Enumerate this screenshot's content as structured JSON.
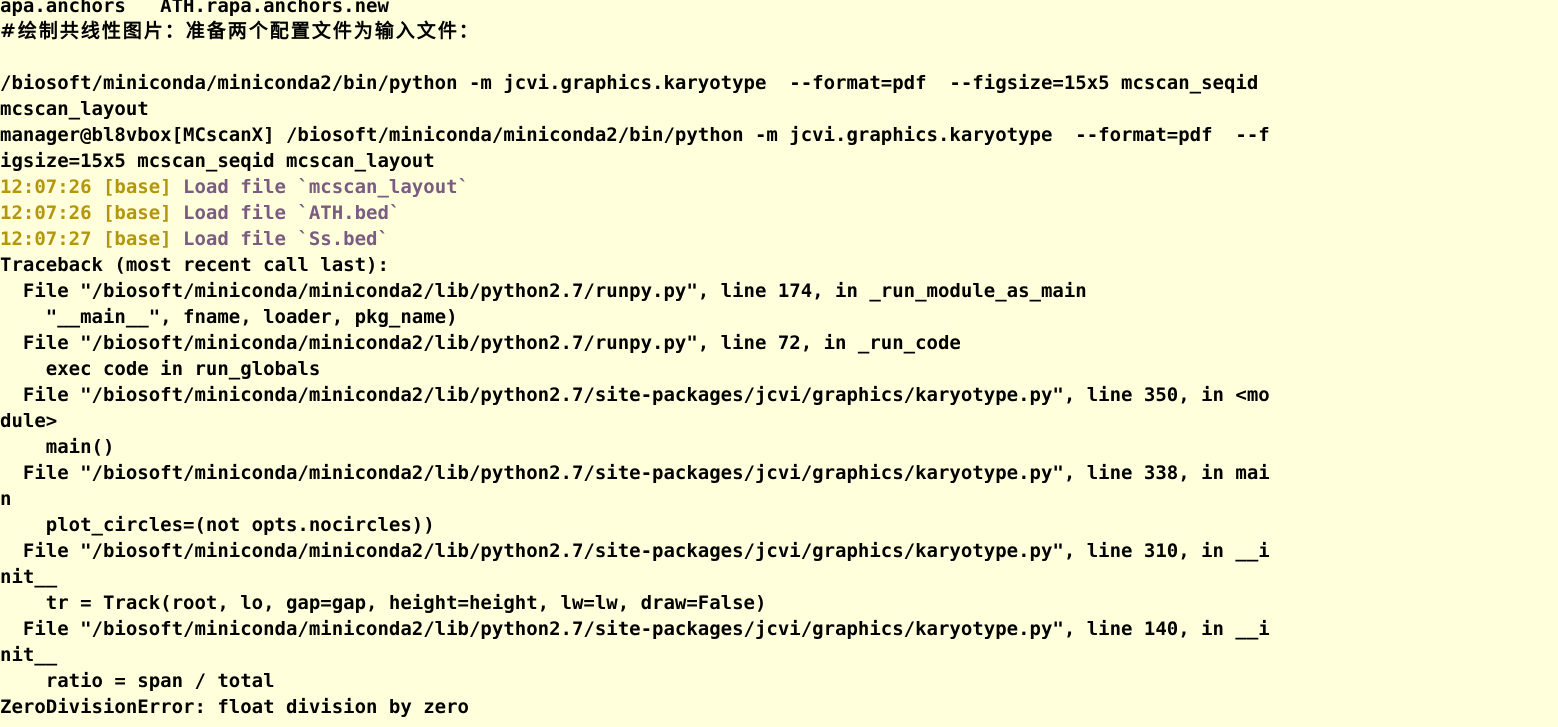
{
  "terminal": {
    "background_color": "#ffffdc",
    "foreground_color": "#000000",
    "timestamp_color": "#b3960c",
    "message_color": "#7a5b82",
    "font_size_px": 19,
    "line_height_px": 26,
    "columns": 80,
    "title": "manager@bl8vbox [MCscanX]"
  },
  "lines": [
    {
      "id": "line-anchors-files",
      "kind": "output",
      "segments": [
        {
          "text": "apa.anchors   ATH.rapa.anchors.new",
          "color": "default"
        }
      ]
    },
    {
      "id": "line-comment-cjk",
      "kind": "comment",
      "cjk": true,
      "segments": [
        {
          "text": "#绘制共线性图片：准备两个配置文件为输入文件：",
          "color": "default"
        }
      ]
    },
    {
      "id": "line-blank-1",
      "kind": "blank",
      "segments": [
        {
          "text": " ",
          "color": "blank"
        }
      ]
    },
    {
      "id": "line-command-wrapped-1",
      "kind": "command",
      "segments": [
        {
          "text": "/biosoft/miniconda/miniconda2/bin/python -m jcvi.graphics.karyotype  --format=pdf  --figsize=15x5 mcscan_seqid",
          "color": "default"
        }
      ]
    },
    {
      "id": "line-command-wrapped-2",
      "kind": "command",
      "segments": [
        {
          "text": "mcscan_layout",
          "color": "default"
        }
      ]
    },
    {
      "id": "line-prompt-command-1",
      "kind": "prompt",
      "segments": [
        {
          "text": "manager@bl8vbox[MCscanX] /biosoft/miniconda/miniconda2/bin/python -m jcvi.graphics.karyotype  --format=pdf  --f",
          "color": "default"
        }
      ]
    },
    {
      "id": "line-prompt-command-2",
      "kind": "prompt",
      "segments": [
        {
          "text": "igsize=15x5 mcscan_seqid mcscan_layout",
          "color": "default"
        }
      ]
    },
    {
      "id": "line-log-1",
      "kind": "log",
      "segments": [
        {
          "text": "12:07:26 [base] ",
          "color": "time"
        },
        {
          "text": "Load file `mcscan_layout`",
          "color": "msg"
        }
      ]
    },
    {
      "id": "line-log-2",
      "kind": "log",
      "segments": [
        {
          "text": "12:07:26 [base] ",
          "color": "time"
        },
        {
          "text": "Load file `ATH.bed`",
          "color": "msg"
        }
      ]
    },
    {
      "id": "line-log-3",
      "kind": "log",
      "segments": [
        {
          "text": "12:07:27 [base] ",
          "color": "time"
        },
        {
          "text": "Load file `Ss.bed`",
          "color": "msg"
        }
      ]
    },
    {
      "id": "line-traceback-header",
      "kind": "error",
      "segments": [
        {
          "text": "Traceback (most recent call last):",
          "color": "default"
        }
      ]
    },
    {
      "id": "line-tb-file-1",
      "kind": "error",
      "segments": [
        {
          "text": "  File \"/biosoft/miniconda/miniconda2/lib/python2.7/runpy.py\", line 174, in _run_module_as_main",
          "color": "default"
        }
      ]
    },
    {
      "id": "line-tb-code-1",
      "kind": "error",
      "segments": [
        {
          "text": "    \"__main__\", fname, loader, pkg_name)",
          "color": "default"
        }
      ]
    },
    {
      "id": "line-tb-file-2",
      "kind": "error",
      "segments": [
        {
          "text": "  File \"/biosoft/miniconda/miniconda2/lib/python2.7/runpy.py\", line 72, in _run_code",
          "color": "default"
        }
      ]
    },
    {
      "id": "line-tb-code-2",
      "kind": "error",
      "segments": [
        {
          "text": "    exec code in run_globals",
          "color": "default"
        }
      ]
    },
    {
      "id": "line-tb-file-3a",
      "kind": "error",
      "segments": [
        {
          "text": "  File \"/biosoft/miniconda/miniconda2/lib/python2.7/site-packages/jcvi/graphics/karyotype.py\", line 350, in <mo",
          "color": "default"
        }
      ]
    },
    {
      "id": "line-tb-file-3b",
      "kind": "error",
      "segments": [
        {
          "text": "dule>",
          "color": "default"
        }
      ]
    },
    {
      "id": "line-tb-code-3",
      "kind": "error",
      "segments": [
        {
          "text": "    main()",
          "color": "default"
        }
      ]
    },
    {
      "id": "line-tb-file-4a",
      "kind": "error",
      "segments": [
        {
          "text": "  File \"/biosoft/miniconda/miniconda2/lib/python2.7/site-packages/jcvi/graphics/karyotype.py\", line 338, in mai",
          "color": "default"
        }
      ]
    },
    {
      "id": "line-tb-file-4b",
      "kind": "error",
      "segments": [
        {
          "text": "n",
          "color": "default"
        }
      ]
    },
    {
      "id": "line-tb-code-4",
      "kind": "error",
      "segments": [
        {
          "text": "    plot_circles=(not opts.nocircles))",
          "color": "default"
        }
      ]
    },
    {
      "id": "line-tb-file-5a",
      "kind": "error",
      "segments": [
        {
          "text": "  File \"/biosoft/miniconda/miniconda2/lib/python2.7/site-packages/jcvi/graphics/karyotype.py\", line 310, in __i",
          "color": "default"
        }
      ]
    },
    {
      "id": "line-tb-file-5b",
      "kind": "error",
      "segments": [
        {
          "text": "nit__",
          "color": "default"
        }
      ]
    },
    {
      "id": "line-tb-code-5",
      "kind": "error",
      "segments": [
        {
          "text": "    tr = Track(root, lo, gap=gap, height=height, lw=lw, draw=False)",
          "color": "default"
        }
      ]
    },
    {
      "id": "line-tb-file-6a",
      "kind": "error",
      "segments": [
        {
          "text": "  File \"/biosoft/miniconda/miniconda2/lib/python2.7/site-packages/jcvi/graphics/karyotype.py\", line 140, in __i",
          "color": "default"
        }
      ]
    },
    {
      "id": "line-tb-file-6b",
      "kind": "error",
      "segments": [
        {
          "text": "nit__",
          "color": "default"
        }
      ]
    },
    {
      "id": "line-tb-code-6",
      "kind": "error",
      "segments": [
        {
          "text": "    ratio = span / total",
          "color": "default"
        }
      ]
    },
    {
      "id": "line-exception",
      "kind": "error",
      "segments": [
        {
          "text": "ZeroDivisionError: float division by zero",
          "color": "default"
        }
      ]
    }
  ]
}
